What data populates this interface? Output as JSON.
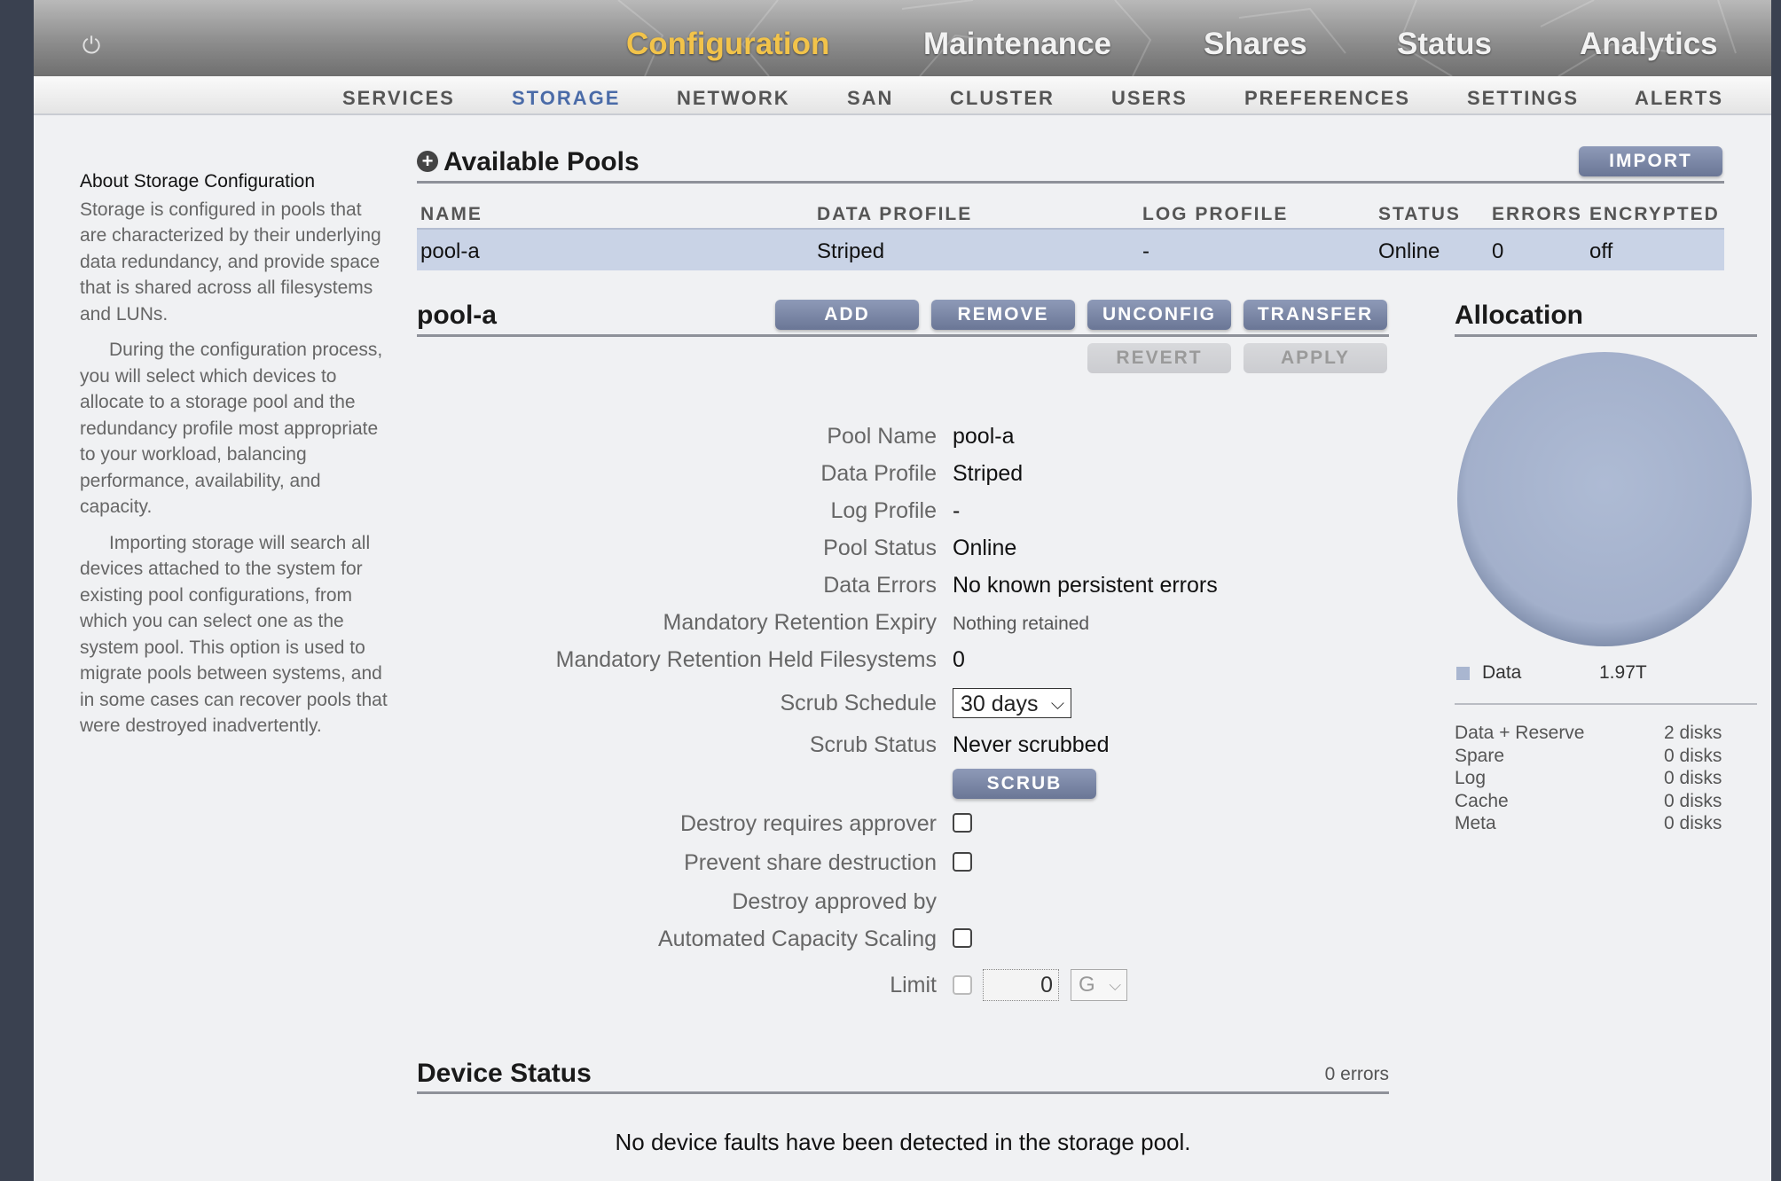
{
  "nav": {
    "main": [
      "Configuration",
      "Maintenance",
      "Shares",
      "Status",
      "Analytics"
    ],
    "sub": [
      "SERVICES",
      "STORAGE",
      "NETWORK",
      "SAN",
      "CLUSTER",
      "USERS",
      "PREFERENCES",
      "SETTINGS",
      "ALERTS"
    ],
    "active_main": "Configuration",
    "active_sub": "STORAGE"
  },
  "help": {
    "title": "About Storage Configuration",
    "p1": "Storage is configured in pools that are characterized by their underlying data redundancy, and provide space that is shared across all filesystems and LUNs.",
    "p2": "During the configuration process, you will select which devices to allocate to a storage pool and the redundancy profile most appropriate to your workload, balancing performance, availability, and capacity.",
    "p3": "Importing storage will search all devices attached to the system for existing pool configurations, from which you can select one as the system pool. This option is used to migrate pools between systems, and in some cases can recover pools that were destroyed inadvertently."
  },
  "pools": {
    "title": "Available Pools",
    "import_label": "IMPORT",
    "columns": [
      "NAME",
      "DATA PROFILE",
      "LOG PROFILE",
      "STATUS",
      "ERRORS",
      "ENCRYPTED"
    ],
    "rows": [
      {
        "name": "pool-a",
        "data_profile": "Striped",
        "log_profile": "-",
        "status": "Online",
        "errors": "0",
        "encrypted": "off"
      }
    ]
  },
  "pool": {
    "title": "pool-a",
    "buttons": {
      "add": "ADD",
      "remove": "REMOVE",
      "unconfig": "UNCONFIG",
      "transfer": "TRANSFER",
      "revert": "REVERT",
      "apply": "APPLY",
      "scrub": "SCRUB"
    },
    "labels": {
      "pool_name": "Pool Name",
      "data_profile": "Data Profile",
      "log_profile": "Log Profile",
      "pool_status": "Pool Status",
      "data_errors": "Data Errors",
      "retention_expiry": "Mandatory Retention Expiry",
      "retention_held": "Mandatory Retention Held Filesystems",
      "scrub_schedule": "Scrub Schedule",
      "scrub_status": "Scrub Status",
      "destroy_requires": "Destroy requires approver",
      "prevent_share": "Prevent share destruction",
      "destroy_approved": "Destroy approved by",
      "auto_scaling": "Automated Capacity Scaling",
      "limit": "Limit"
    },
    "values": {
      "pool_name": "pool-a",
      "data_profile": "Striped",
      "log_profile": "-",
      "pool_status": "Online",
      "data_errors": "No known persistent errors",
      "retention_expiry": "Nothing retained",
      "retention_held": "0",
      "scrub_schedule": "30 days",
      "scrub_status": "Never scrubbed",
      "destroy_requires": false,
      "prevent_share": false,
      "auto_scaling": false,
      "limit_enabled": false,
      "limit_value": "0",
      "limit_unit": "G"
    }
  },
  "allocation": {
    "title": "Allocation",
    "pie_color": "#a9b6d0",
    "legend": [
      {
        "label": "Data",
        "value": "1.97T",
        "color": "#a9b6d0"
      }
    ],
    "disks": [
      {
        "label": "Data + Reserve",
        "value": "2 disks"
      },
      {
        "label": "Spare",
        "value": "0 disks"
      },
      {
        "label": "Log",
        "value": "0 disks"
      },
      {
        "label": "Cache",
        "value": "0 disks"
      },
      {
        "label": "Meta",
        "value": "0 disks"
      }
    ]
  },
  "device_status": {
    "title": "Device Status",
    "errors": "0 errors",
    "message": "No device faults have been detected in the storage pool."
  }
}
